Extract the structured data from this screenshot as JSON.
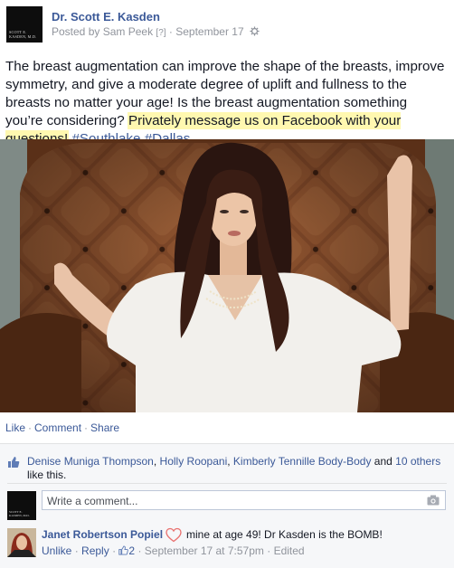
{
  "post": {
    "author": "Dr. Scott E. Kasden",
    "logo_text": "SCOTT E. KASDEN, M.D.",
    "posted_by_prefix": "Posted by",
    "posted_by_name": "Sam Peek",
    "posted_by_help": "[?]",
    "date": "September 17",
    "separator": "·",
    "text_main": "The breast augmentation can improve the shape of the breasts, improve symmetry, and give a moderate degree of uplift and fullness to the breasts no matter your age! Is the breast augmentation something you’re considering?",
    "text_highlight": "Privately message us on Facebook with your questions!",
    "hashtags": [
      "#Southlake",
      "#Dallas"
    ],
    "photo_icon": "photo-of-woman-in-leather-chair"
  },
  "actions": {
    "like": "Like",
    "comment": "Comment",
    "share": "Share"
  },
  "likes": {
    "names": [
      "Denise Muniga Thompson",
      "Holly Roopani",
      "Kimberly Tennille Body-Body"
    ],
    "and_text": "and",
    "others": "10 others",
    "suffix": "like this."
  },
  "comment_box": {
    "placeholder": "Write a comment...",
    "icon": "camera-icon"
  },
  "comment": {
    "author": "Janet Robertson Popiel",
    "text": "mine at age 49! Dr Kasden is the BOMB!",
    "unlike": "Unlike",
    "reply": "Reply",
    "like_count": "2",
    "timestamp": "September 17 at 7:57pm",
    "edited": "Edited"
  },
  "colors": {
    "link": "#3b5998",
    "meta": "#90949c",
    "highlight": "#fff8b0",
    "heart": "#e9716f"
  }
}
